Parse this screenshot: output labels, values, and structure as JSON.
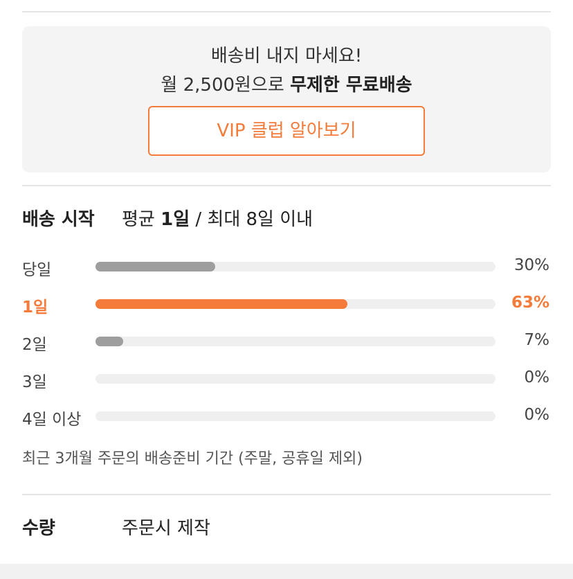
{
  "promo": {
    "line1": "배송비 내지 마세요!",
    "line2_prefix": "월 2,500원으로 ",
    "line2_bold": "무제한 무료배송",
    "button_label": "VIP 클럽 알아보기"
  },
  "shipping": {
    "label": "배송 시작",
    "avg_prefix": "평균 ",
    "avg_value": "1일",
    "max_text": " / 최대 8일 이내",
    "rows": [
      {
        "label": "당일",
        "percent": 30,
        "percent_text": "30%"
      },
      {
        "label": "1일",
        "percent": 63,
        "percent_text": "63%"
      },
      {
        "label": "2일",
        "percent": 7,
        "percent_text": "7%"
      },
      {
        "label": "3일",
        "percent": 0,
        "percent_text": "0%"
      },
      {
        "label": "4일 이상",
        "percent": 0,
        "percent_text": "0%"
      }
    ],
    "note": "최근 3개월 주문의 배송준비 기간 (주말, 공휴일 제외)"
  },
  "quantity": {
    "label": "수량",
    "value": "주문시 제작"
  },
  "colors": {
    "accent": "#f47b3a",
    "bar_default": "#9e9e9e",
    "track": "#efefef"
  }
}
